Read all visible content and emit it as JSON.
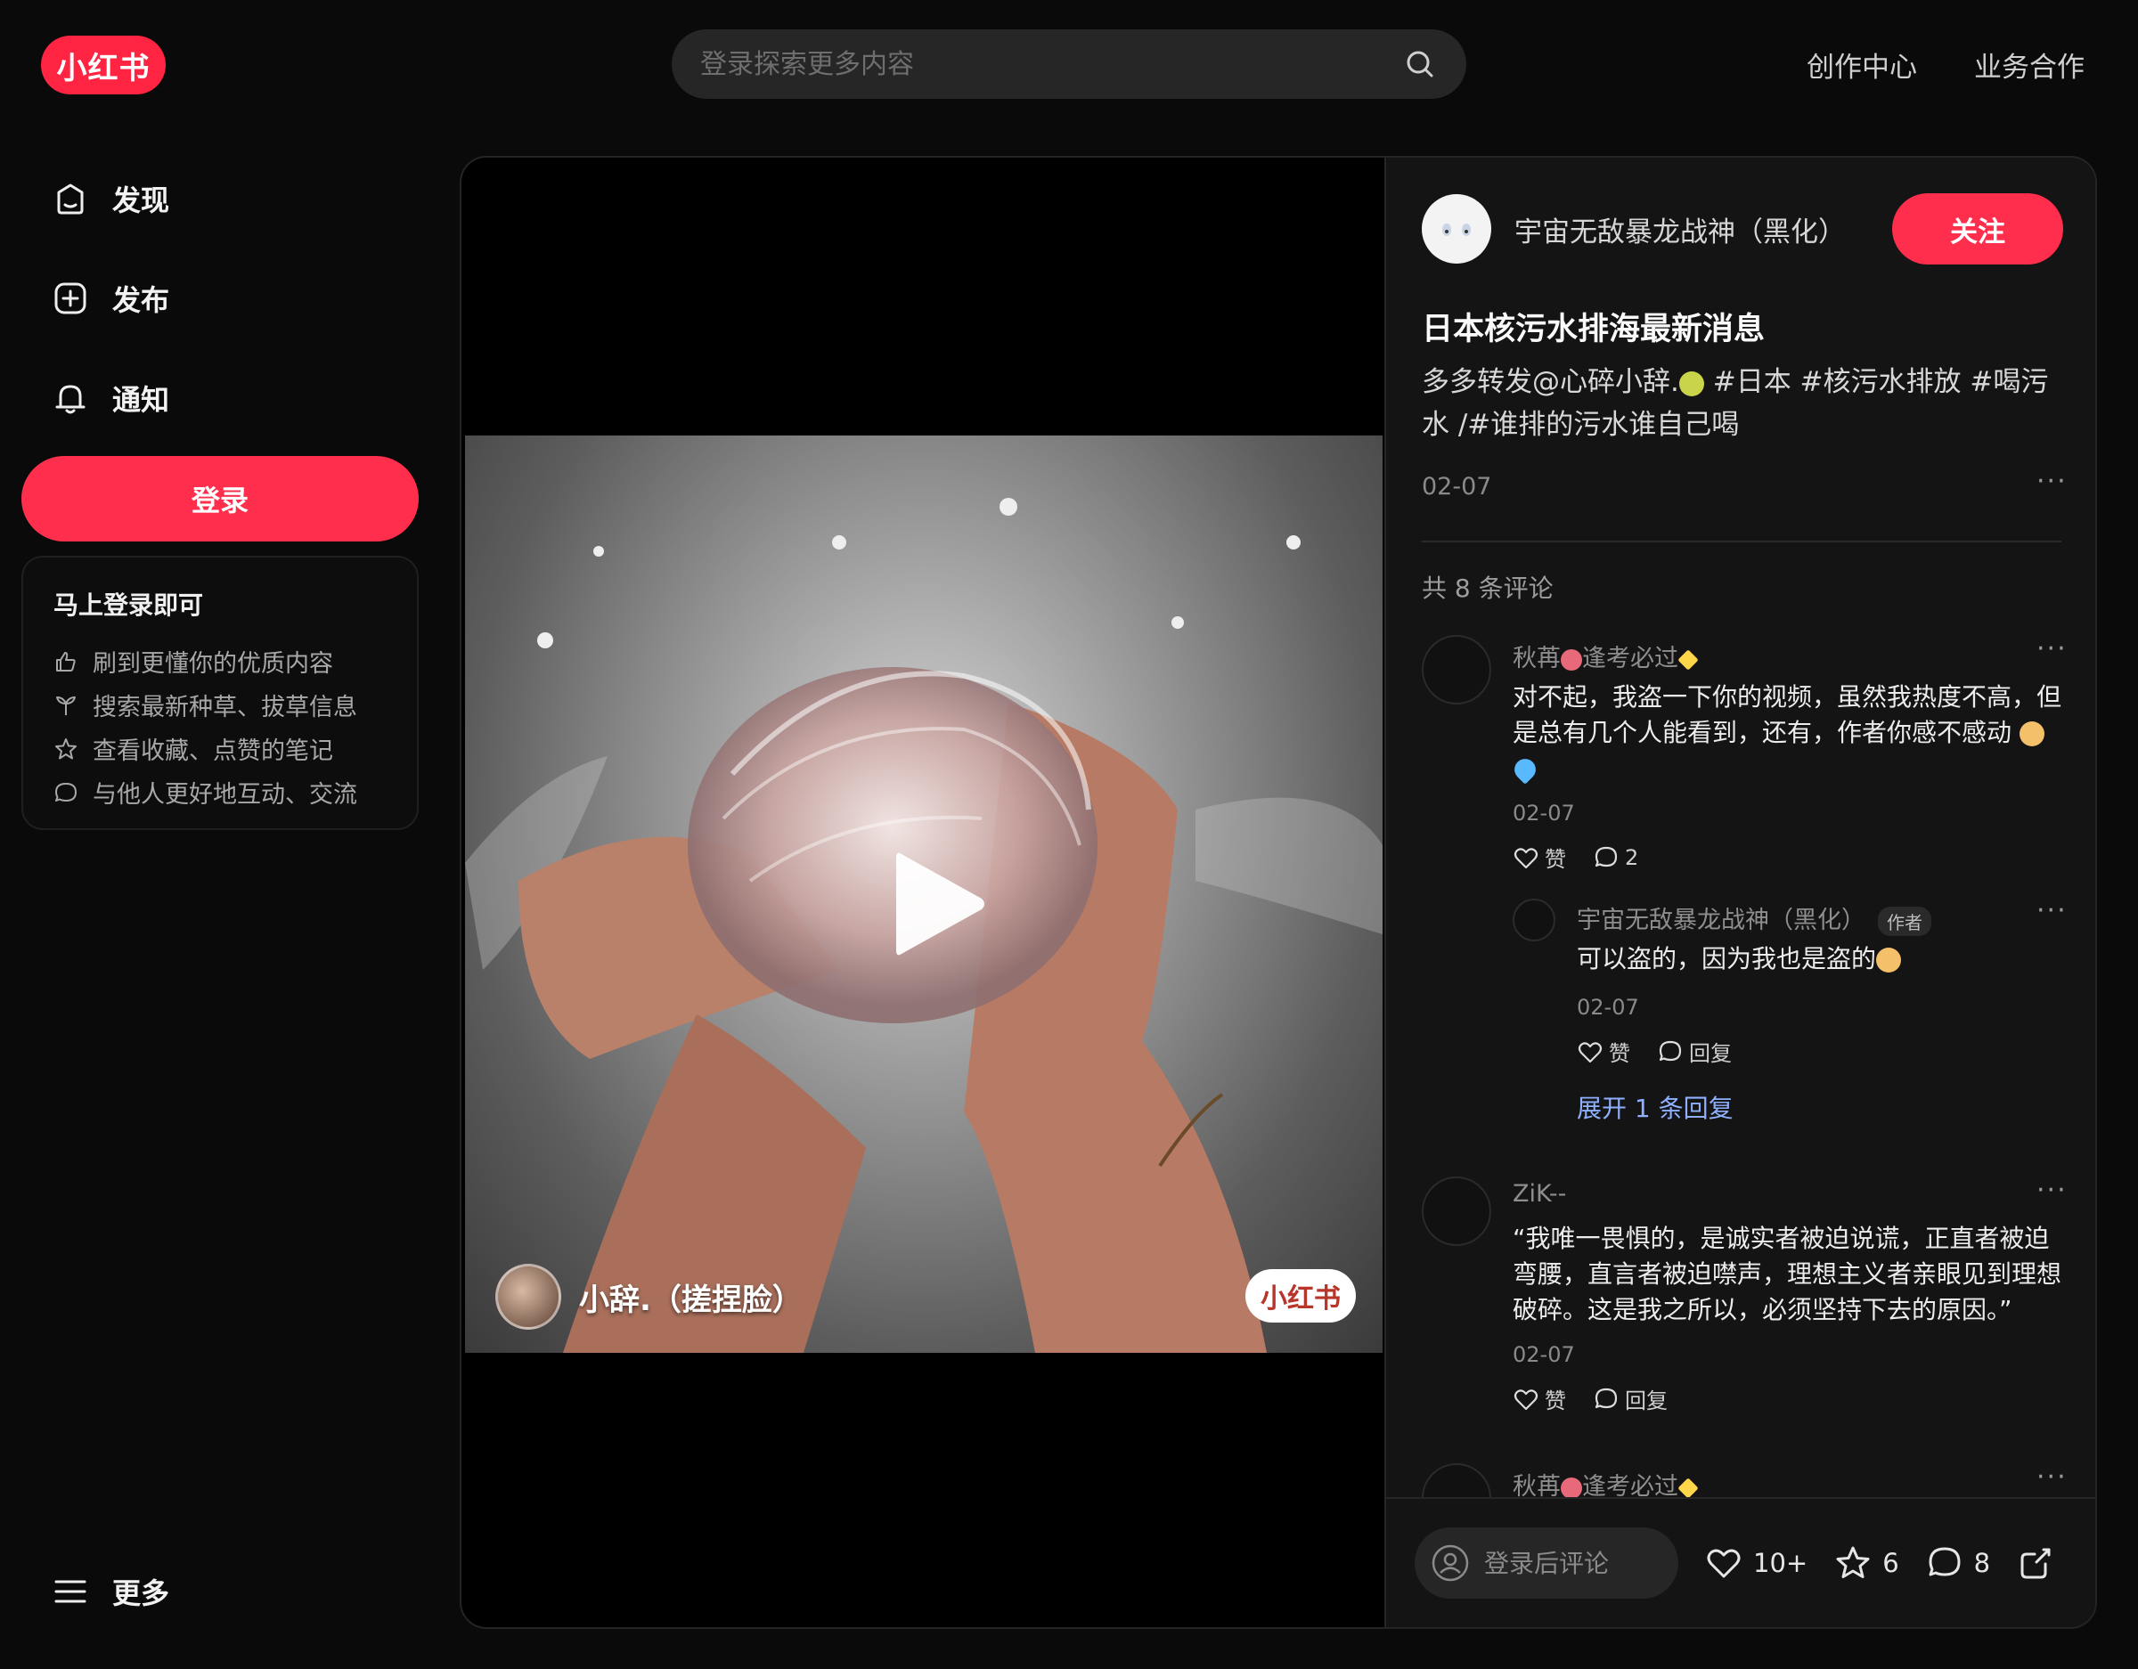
{
  "header": {
    "logo": "小红书",
    "search_placeholder": "登录探索更多内容",
    "nav": [
      "创作中心",
      "业务合作"
    ]
  },
  "sidebar": {
    "items": [
      {
        "label": "发现",
        "icon": "home-icon"
      },
      {
        "label": "发布",
        "icon": "plus-square-icon"
      },
      {
        "label": "通知",
        "icon": "bell-icon"
      }
    ],
    "login_button": "登录",
    "login_card": {
      "title": "马上登录即可",
      "rows": [
        {
          "icon": "thumb-up-icon",
          "text": "刷到更懂你的优质内容"
        },
        {
          "icon": "sprout-icon",
          "text": "搜索最新种草、拔草信息"
        },
        {
          "icon": "star-icon",
          "text": "查看收藏、点赞的笔记"
        },
        {
          "icon": "chat-icon",
          "text": "与他人更好地互动、交流"
        }
      ]
    },
    "more": "更多"
  },
  "video": {
    "watermark_user": "小辞.（搓捏脸）",
    "watermark_logo": "小红书"
  },
  "note": {
    "author": "宇宙无敌暴龙战神（黑化）",
    "follow": "关注",
    "title": "日本核污水排海最新消息",
    "desc_part1": "多多转发@心碎小辞.",
    "desc_part2": " #日本 #核污水排放 #喝污水 /#谁排的污水谁自己喝",
    "date": "02-07",
    "comment_count": "共 8 条评论"
  },
  "comments": [
    {
      "name_a": "秋苒",
      "name_b": "逢考必过",
      "text": "对不起，我盗一下你的视频，虽然我热度不高，但是总有几个人能看到，还有，作者你感不感动",
      "date": "02-07",
      "like": "赞",
      "reply_count": "2",
      "replies": [
        {
          "name": "宇宙无敌暴龙战神（黑化）",
          "badge": "作者",
          "text": "可以盗的，因为我也是盗的",
          "date": "02-07",
          "like": "赞",
          "reply": "回复"
        }
      ],
      "expand": "展开 1 条回复"
    },
    {
      "name": "ZiK--",
      "text": "“我唯一畏惧的，是诚实者被迫说谎，正直者被迫弯腰，直言者被迫噤声，理想主义者亲眼见到理想破碎。这是我之所以，必须坚持下去的原因。”",
      "date": "02-07",
      "like": "赞",
      "reply": "回复"
    },
    {
      "name_a": "秋苒",
      "name_b": "逢考必过"
    }
  ],
  "bottom": {
    "placeholder": "登录后评论",
    "likes": "10+",
    "collects": "6",
    "comments": "8"
  },
  "colors": {
    "brand": "#ff2442",
    "background": "#0a0a0a",
    "panel": "#141414",
    "link": "#8fb0ff"
  }
}
